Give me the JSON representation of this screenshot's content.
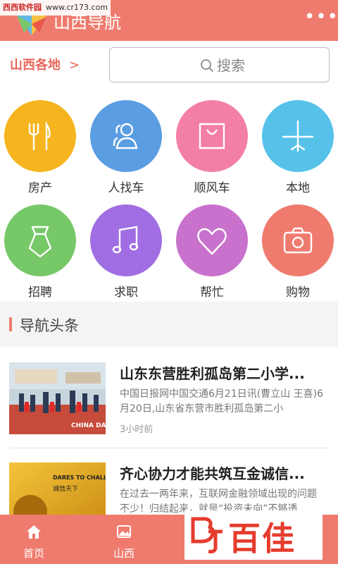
{
  "header": {
    "title": "山西导航",
    "more_label": "•••"
  },
  "watermark_top": {
    "site": "西西软件园",
    "url": "www.cr173.com"
  },
  "search_row": {
    "region": "山西各地",
    "region_chevron": ">",
    "search_placeholder": "搜索"
  },
  "categories": [
    {
      "label": "房产",
      "icon": "fork-knife-icon",
      "color": "#f6b41e"
    },
    {
      "label": "人找车",
      "icon": "people-icon",
      "color": "#5a9de2"
    },
    {
      "label": "顺风车",
      "icon": "bag-icon",
      "color": "#f37fa6"
    },
    {
      "label": "本地",
      "icon": "airplane-icon",
      "color": "#56c2e9"
    },
    {
      "label": "招聘",
      "icon": "necktie-icon",
      "color": "#77c868"
    },
    {
      "label": "求职",
      "icon": "music-note-icon",
      "color": "#a06ee2"
    },
    {
      "label": "帮忙",
      "icon": "heart-icon",
      "color": "#c972cd"
    },
    {
      "label": "购物",
      "icon": "camera-icon",
      "color": "#ef7b6e"
    }
  ],
  "news": {
    "section_title": "导航头条",
    "items": [
      {
        "title": "山东东营胜利孤岛第二小学...",
        "summary": "中国日报网中国交通6月21日讯(曹立山 王喜)6月20日,山东省东营市胜利孤岛第二小",
        "time": "3小时前",
        "thumb_caption": "CHINA DAILY"
      },
      {
        "title": "齐心协力才能共筑互金诚信...",
        "summary": "在过去一两年来，互联网金融领域出现的问题不少！归结起来，就是“投资未向”不够透",
        "thumb_caption": "DARES TO CHALLENGE",
        "thumb_subcaption": "诚信天下"
      }
    ]
  },
  "tabbar": {
    "tabs": [
      {
        "label": "首页",
        "icon": "home-icon"
      },
      {
        "label": "山西",
        "icon": "image-icon"
      }
    ]
  },
  "brand_watermark": {
    "text": "百佳"
  },
  "colors": {
    "accent": "#ef7b6e",
    "region_text": "#e8665a",
    "brand_red": "#e53c2e"
  }
}
